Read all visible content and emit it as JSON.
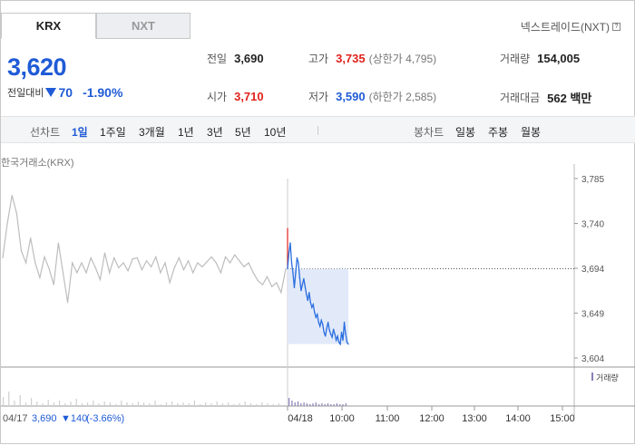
{
  "tabs": [
    {
      "label": "KRX",
      "active": true
    },
    {
      "label": "NXT",
      "active": false
    }
  ],
  "header": {
    "nxt_trade_label": "넥스트레이드(NXT)",
    "help_icon": "?"
  },
  "quote": {
    "price": "3,620",
    "change_label": "전일대비",
    "change_value": "70",
    "change_pct": "-1.90%",
    "direction_icon": "down-triangle-icon"
  },
  "stats": {
    "prev_close": {
      "label": "전일",
      "value": "3,690"
    },
    "high": {
      "label": "고가",
      "value": "3,735",
      "sub": "(상한가 4,795)"
    },
    "volume": {
      "label": "거래량",
      "value": "154,005"
    },
    "open": {
      "label": "시가",
      "value": "3,710"
    },
    "low": {
      "label": "저가",
      "value": "3,590",
      "sub": "(하한가 2,585)"
    },
    "amount": {
      "label": "거래대금",
      "value": "562 백만"
    }
  },
  "toolbar": {
    "line_label": "선차트",
    "periods": [
      "1일",
      "1주일",
      "3개월",
      "1년",
      "3년",
      "5년",
      "10년"
    ],
    "active_period": "1일",
    "candle_label": "봉차트",
    "candle_periods": [
      "일봉",
      "주봉",
      "월봉"
    ]
  },
  "chart_source": "한국거래소(KRX)",
  "chart_data": {
    "type": "line",
    "y_ticks": [
      "3,785",
      "3,740",
      "3,694",
      "3,649",
      "3,604"
    ],
    "ylim": [
      3604,
      3785
    ],
    "reference_line": 3694,
    "x_ticks": [
      "04/18",
      "10:00",
      "11:00",
      "12:00",
      "13:00",
      "14:00",
      "15:00"
    ],
    "series": [
      {
        "values": [
          3694,
          3710,
          3720,
          3700,
          3690,
          3675,
          3690,
          3705,
          3700,
          3685,
          3672,
          3678,
          3684,
          3676,
          3668,
          3662,
          3670,
          3660,
          3655,
          3658,
          3650,
          3645,
          3648,
          3640,
          3636,
          3642,
          3638,
          3630,
          3626,
          3634,
          3640,
          3632,
          3628,
          3625,
          3633,
          3628,
          3622,
          3626,
          3620,
          3618,
          3630,
          3622,
          3640,
          3628,
          3620,
          3618
        ]
      }
    ],
    "prev_day_series": {
      "values": [
        3705,
        3740,
        3768,
        3750,
        3712,
        3700,
        3725,
        3700,
        3685,
        3706,
        3694,
        3678,
        3720,
        3690,
        3660,
        3700,
        3690,
        3700,
        3690,
        3705,
        3695,
        3683,
        3710,
        3690,
        3705,
        3695,
        3700,
        3692,
        3704,
        3705,
        3693,
        3702,
        3696,
        3706,
        3690,
        3700,
        3680,
        3695,
        3705,
        3693,
        3702,
        3690,
        3700,
        3696,
        3701,
        3706,
        3700,
        3690,
        3706,
        3700,
        3708,
        3702,
        3696,
        3700,
        3690,
        3682,
        3678,
        3686,
        3676,
        3680,
        3670,
        3694
      ]
    },
    "legend": "거래량"
  },
  "footer": {
    "prev_date": "04/17",
    "prev_close": "3,690",
    "prev_change": "▼140",
    "prev_pct": "(-3.66%)"
  }
}
